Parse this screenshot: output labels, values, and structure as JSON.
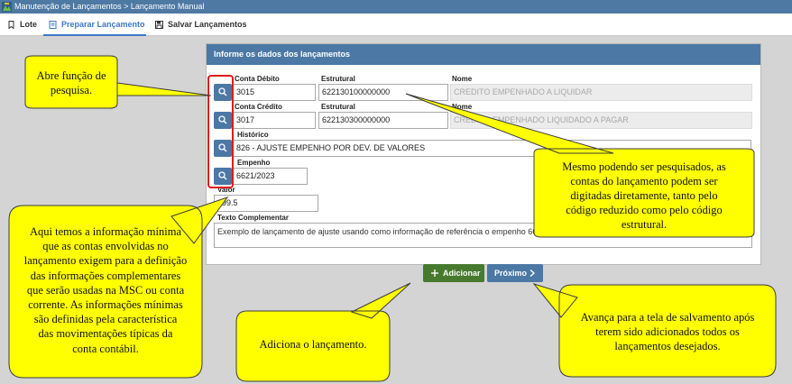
{
  "window": {
    "breadcrumb": "Manutenção de Lançamentos > Lançamento Manual"
  },
  "tabs": [
    {
      "label": "Lote",
      "icon": "bookmark-icon"
    },
    {
      "label": "Preparar Lançamento",
      "icon": "document-icon"
    },
    {
      "label": "Salvar Lançamentos",
      "icon": "floppy-disk-icon"
    }
  ],
  "active_tab": "Preparar Lançamento",
  "panel": {
    "title": "Informe os dados dos lançamentos"
  },
  "form": {
    "debit": {
      "account_label": "Conta Débito",
      "account_value": "3015",
      "structural_label": "Estrutural",
      "structural_value": "622130100000000",
      "name_label": "Nome",
      "name_value": "CREDITO EMPENHADO A LIQUIDAR"
    },
    "credit": {
      "account_label": "Conta Crédito",
      "account_value": "3017",
      "structural_label": "Estrutural",
      "structural_value": "622130300000000",
      "name_label": "Nome",
      "name_value": "CREDITO EMPENHADO LIQUIDADO A PAGAR"
    },
    "history": {
      "label": "Histórico",
      "value": "826 - AJUSTE EMPENHO POR DEV. DE VALORES"
    },
    "commitment": {
      "label": "Empenho",
      "value": "6621/2023"
    },
    "amount": {
      "label": "Valor",
      "value": "199.5"
    },
    "complement": {
      "label": "Texto Complementar",
      "value": "Exemplo de lançamento de ajuste usando como informação de referência o empenho 6621/2023."
    }
  },
  "buttons": {
    "add": "Adicionar",
    "next": "Próximo"
  },
  "callouts": {
    "search": [
      "Abre função de",
      "pesquisa."
    ],
    "accounts": [
      "Mesmo podendo ser pesquisados, as",
      "contas do lançamento podem ser",
      "digitadas diretamente, tanto pelo",
      "código reduzido como pelo código",
      "estrutural."
    ],
    "minimum": [
      "Aqui temos a informação mínima",
      "que as contas envolvidas no",
      "lançamento exigem para a definição",
      "das informações complementares",
      "que serão usadas na MSC ou conta",
      "corrente. As informações mínimas",
      "são definidas pela característica",
      "das movimentações típicas da",
      "conta contábil."
    ],
    "add": [
      "Adiciona o lançamento."
    ],
    "next": [
      "Avança para a tela de salvamento após",
      "terem sido adicionados todos os",
      "lançamentos desejados."
    ]
  },
  "colors": {
    "header_blue": "#4b78a5",
    "add_green": "#477a2e",
    "callout_yellow": "#ffff00",
    "highlight_red": "#e11919"
  }
}
